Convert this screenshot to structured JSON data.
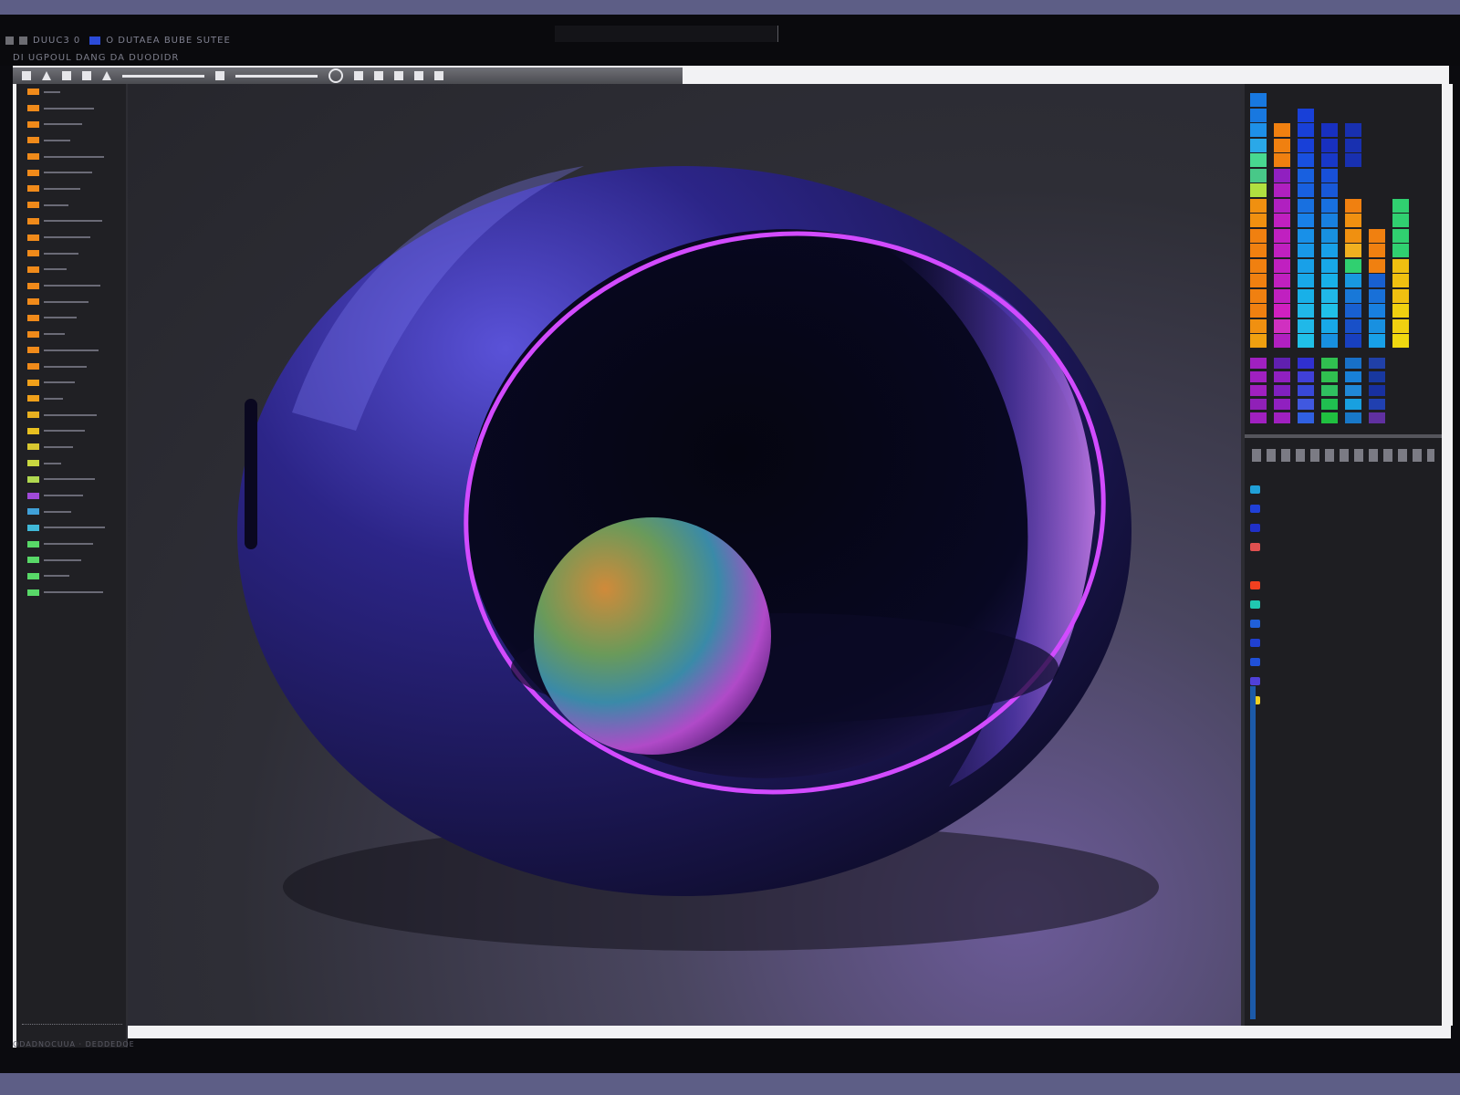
{
  "app": {
    "title": "DUUC3 0",
    "title_extra": "O DUTAEA BUBE SUTEE",
    "menu": "DI UGPOUL DANG DA DUODIDR",
    "status": "ODADNOCUUA · DEDDEDOE"
  },
  "colors": {
    "accent": "#2b4bd8",
    "rim_glow": "#d24bff",
    "shell": "#2a2370",
    "background": "#5d5e86"
  },
  "toolbar": {
    "tools": [
      "select-tool",
      "brush-tool",
      "shape-tool",
      "text-tool",
      "pen-tool",
      "ruler-tool",
      "line-tool",
      "zoom-tool",
      "circle-tool",
      "move-tool",
      "fill-tool",
      "eyedrop-tool",
      "crop-tool",
      "export-tool"
    ]
  },
  "layers": {
    "chip_colors": [
      "#f08a1a",
      "#f08a1a",
      "#f08a1a",
      "#f08a1a",
      "#f08a1a",
      "#f08a1a",
      "#f08a1a",
      "#f08a1a",
      "#f08a1a",
      "#f08a1a",
      "#f08a1a",
      "#f08a1a",
      "#f08a1a",
      "#f08a1a",
      "#f08a1a",
      "#f08a1a",
      "#f08a1a",
      "#f08a1a",
      "#f0a01a",
      "#f0a01a",
      "#e8b020",
      "#e8c020",
      "#d8c830",
      "#c8d840",
      "#b0d850",
      "#a04ad8",
      "#40a0d8",
      "#40b8d8",
      "#58d868",
      "#58d868",
      "#58d868",
      "#58d868"
    ]
  },
  "palette": {
    "columns": [
      [
        "#1878e0",
        "#1878e0",
        "#1e90e8",
        "#2aa8e8",
        "#48d890",
        "#48c888",
        "#b0e040",
        "#f09010",
        "#f09010",
        "#f08010",
        "#f08010",
        "#f08010",
        "#f08010",
        "#f08010",
        "#f08010",
        "#f09010",
        "#f0a010"
      ],
      [
        "",
        "",
        "#f08010",
        "#f08010",
        "#f08010",
        "#9020c0",
        "#b020c0",
        "#b020c0",
        "#c020c0",
        "#c020c0",
        "#c020c0",
        "#c020c0",
        "#c020c0",
        "#c020c0",
        "#d020c0",
        "#d030c0",
        "#b020c0"
      ],
      [
        "",
        "#1840d8",
        "#1840d8",
        "#1840d8",
        "#1850e0",
        "#1860e0",
        "#1860e0",
        "#1870e0",
        "#1880e8",
        "#1890e8",
        "#1898e8",
        "#18a0e8",
        "#18a8e8",
        "#18b0e8",
        "#20b8e8",
        "#20b8e8",
        "#20c0e8"
      ],
      [
        "",
        "",
        "#1830c0",
        "#1830c0",
        "#1838c8",
        "#1850d8",
        "#1858d8",
        "#1870e0",
        "#1880e0",
        "#1890e0",
        "#18a0e8",
        "#18a8e8",
        "#18b0e8",
        "#20b8e8",
        "#20c0e8",
        "#18a8e8",
        "#1890e0"
      ],
      [
        "",
        "",
        "#1830b0",
        "#1830b0",
        "#1830b0",
        "",
        "",
        "#f08010",
        "#f09010",
        "#f09010",
        "#f0b020",
        "#30d070",
        "#1898e0",
        "#1878d8",
        "#1860d0",
        "#1850c8",
        "#1840c0"
      ],
      [
        "",
        "",
        "",
        "",
        "",
        "",
        "",
        "",
        "",
        "#f08010",
        "#f08010",
        "#f08010",
        "#1860d0",
        "#1870d8",
        "#1880e0",
        "#1890e0",
        "#18a0e8"
      ],
      [
        "",
        "",
        "",
        "",
        "",
        "",
        "",
        "#30d070",
        "#30d070",
        "#30d070",
        "#30d070",
        "#f0c010",
        "#f0c010",
        "#f0c010",
        "#f0d010",
        "#f0d010",
        "#f0d810"
      ]
    ],
    "lower_columns": [
      [
        "#a020c0",
        "#a020c0",
        "#a020c0",
        "#9020b8",
        "#a020c0"
      ],
      [
        "#6020b0",
        "#9020c0",
        "#8020c0",
        "#9020c0",
        "#a020c0"
      ],
      [
        "#3030d0",
        "#4040d8",
        "#3848d8",
        "#4058e0",
        "#3060e0"
      ],
      [
        "#30c050",
        "#30c050",
        "#30c060",
        "#20c050",
        "#20c040"
      ],
      [
        "#1870c8",
        "#1880d8",
        "#2088d8",
        "#18a0e0",
        "#1878c8"
      ],
      [
        "#2040a8",
        "#1838a0",
        "#1830a0",
        "#2040b0",
        "#6030a0"
      ]
    ]
  },
  "channels": {
    "dot_colors": [
      "#20a0d8",
      "#2040d8",
      "#2030c8",
      "#e05050",
      "#1e1e22",
      "#f04020",
      "#20c8b0",
      "#2060d8",
      "#2040d0",
      "#2050d8",
      "#5040d8",
      "#f0d020"
    ]
  }
}
